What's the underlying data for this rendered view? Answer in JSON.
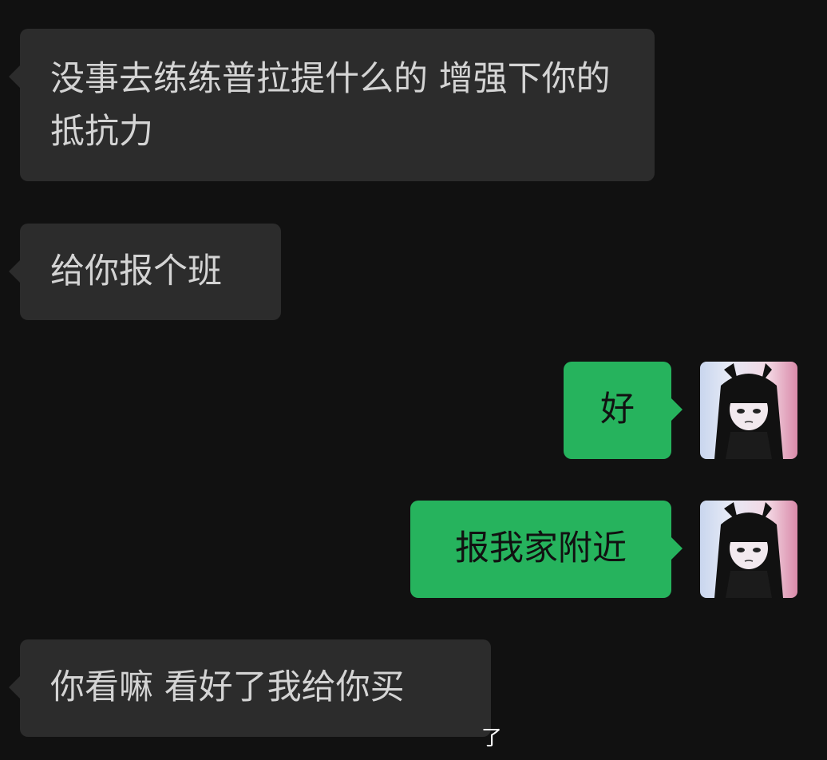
{
  "messages": [
    {
      "direction": "incoming",
      "text": "没事去练练普拉提什么的 增强下你的抵抗力"
    },
    {
      "direction": "incoming",
      "text": "给你报个班"
    },
    {
      "direction": "outgoing",
      "text": "好"
    },
    {
      "direction": "outgoing",
      "text": "报我家附近"
    },
    {
      "direction": "incoming",
      "text": "你看嘛 看好了我给你买"
    }
  ],
  "bottom_partial_text": "了",
  "colors": {
    "background": "#111111",
    "incoming_bubble": "#2c2c2c",
    "outgoing_bubble": "#26b35d"
  },
  "icons": {
    "avatar": "anime-girl-cat-ears-avatar"
  }
}
